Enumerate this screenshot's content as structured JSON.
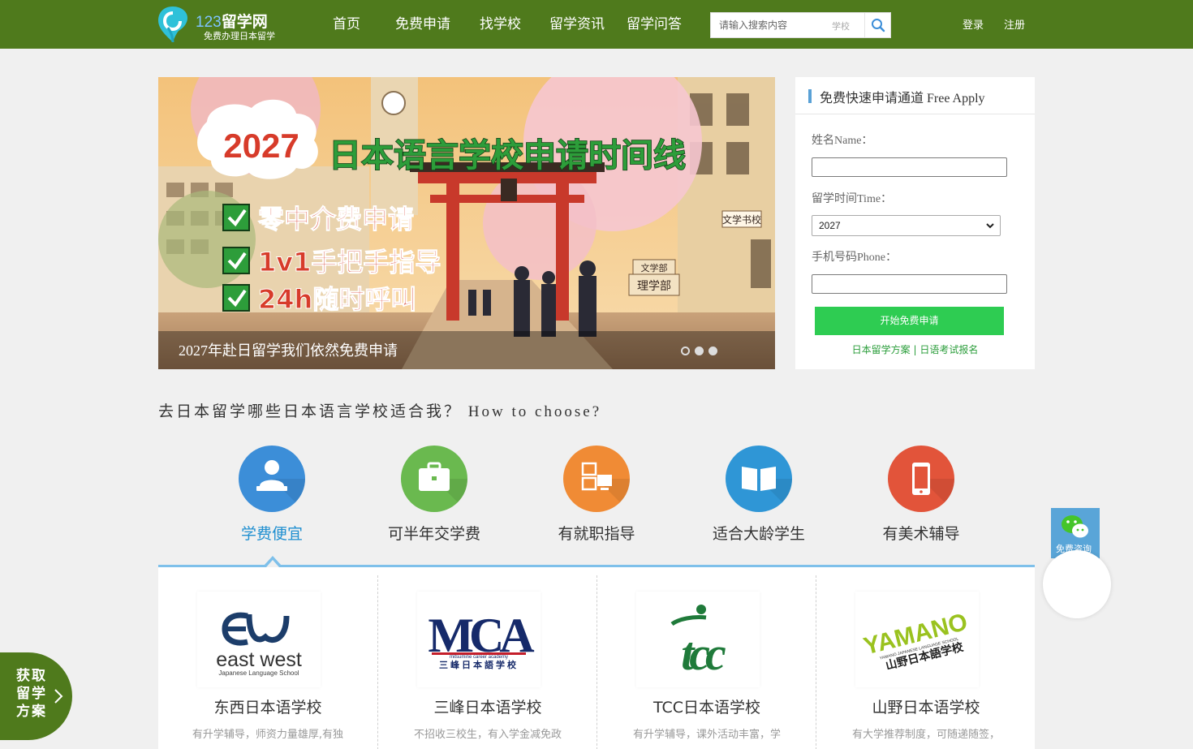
{
  "header": {
    "logo_title_num": "123",
    "logo_title_text": "留学网",
    "logo_sub": "免费办理日本留学",
    "nav": [
      "首页",
      "免费申请",
      "找学校",
      "留学资讯",
      "留学问答"
    ],
    "search_placeholder": "请输入搜索内容",
    "search_scope": "学校",
    "login": "登录",
    "register": "注册",
    "brand_color": "#4f7a1c"
  },
  "banner": {
    "year_text": "2027",
    "headline": "日本语言学校申请时间线",
    "checks": [
      "零中介费申请",
      "1v1手把手指导",
      "24h随时呼叫"
    ],
    "caption": "2027年赴日留学我们依然免费申请",
    "sign_1": "文学书校",
    "sign_2": "文学部",
    "sign_3": "理学部",
    "dots": 3,
    "active_dot": 0
  },
  "apply": {
    "title": "免费快速申请通道 Free Apply",
    "name_label": "姓名Name：",
    "time_label": "留学时间Time：",
    "time_value": "2027",
    "phone_label": "手机号码Phone：",
    "submit": "开始免费申请",
    "link_1": "日本留学方案",
    "link_sep": " | ",
    "link_2": "日语考试报名"
  },
  "choose": {
    "title": "去日本留学哪些日本语言学校适合我？ How to choose?",
    "features": [
      {
        "label": "学费便宜",
        "color": "#3c8ed8",
        "icon": "person-laptop-icon"
      },
      {
        "label": "可半年交学费",
        "color": "#6ab94f",
        "icon": "briefcase-icon"
      },
      {
        "label": "有就职指导",
        "color": "#f08b35",
        "icon": "computer-network-icon"
      },
      {
        "label": "适合大龄学生",
        "color": "#2f96d6",
        "icon": "open-book-icon"
      },
      {
        "label": "有美术辅导",
        "color": "#e2543a",
        "icon": "mobile-phone-icon"
      }
    ],
    "active_index": 0
  },
  "schools": [
    {
      "name": "东西日本语学校",
      "desc": "有升学辅导，师资力量雄厚,有独",
      "logo_text": "east west",
      "logo_sub": "Japanese Language School"
    },
    {
      "name": "三峰日本语学校",
      "desc": "不招收三校生，有入学金减免政",
      "logo_text": "MCA",
      "logo_sub": "三峰日本語学校",
      "logo_tiny": "mitsumine career academy"
    },
    {
      "name": "TCC日本语学校",
      "desc": "有升学辅导，课外活动丰富，学",
      "logo_text": "tcc"
    },
    {
      "name": "山野日本语学校",
      "desc": "有大学推荐制度，可随递随签，",
      "logo_text": "YAMANO",
      "logo_sub": "山野日本語学校",
      "logo_tiny": "YAMANO JAPANESE LANGUAGE SCHOOL"
    }
  ],
  "floats": {
    "wechat_label": "免费咨询",
    "left_text": "获取留学方案"
  }
}
